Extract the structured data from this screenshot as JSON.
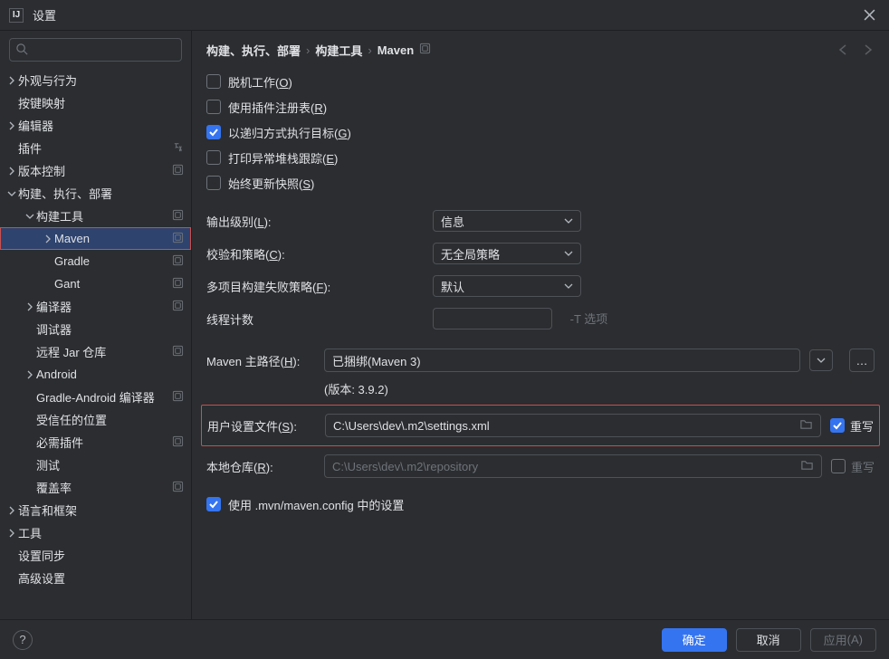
{
  "window": {
    "title": "设置"
  },
  "search": {
    "placeholder": ""
  },
  "sidebar": {
    "items": [
      {
        "label": "外观与行为",
        "indent": 0,
        "arrow": "right"
      },
      {
        "label": "按键映射",
        "indent": 0
      },
      {
        "label": "编辑器",
        "indent": 0,
        "arrow": "right"
      },
      {
        "label": "插件",
        "indent": 0,
        "lang": true
      },
      {
        "label": "版本控制",
        "indent": 0,
        "arrow": "right",
        "proj": true
      },
      {
        "label": "构建、执行、部署",
        "indent": 0,
        "arrow": "down"
      },
      {
        "label": "构建工具",
        "indent": 1,
        "arrow": "down",
        "proj": true
      },
      {
        "label": "Maven",
        "indent": 2,
        "arrow": "right",
        "proj": true,
        "selected": true
      },
      {
        "label": "Gradle",
        "indent": 2,
        "proj": true
      },
      {
        "label": "Gant",
        "indent": 2,
        "proj": true
      },
      {
        "label": "编译器",
        "indent": 1,
        "arrow": "right",
        "proj": true
      },
      {
        "label": "调试器",
        "indent": 1
      },
      {
        "label": "远程 Jar 仓库",
        "indent": 1,
        "proj": true
      },
      {
        "label": "Android",
        "indent": 1,
        "arrow": "right"
      },
      {
        "label": "Gradle-Android 编译器",
        "indent": 1,
        "proj": true
      },
      {
        "label": "受信任的位置",
        "indent": 1
      },
      {
        "label": "必需插件",
        "indent": 1,
        "proj": true
      },
      {
        "label": "测试",
        "indent": 1
      },
      {
        "label": "覆盖率",
        "indent": 1,
        "proj": true
      },
      {
        "label": "语言和框架",
        "indent": 0,
        "arrow": "right"
      },
      {
        "label": "工具",
        "indent": 0,
        "arrow": "right"
      },
      {
        "label": "设置同步",
        "indent": 0
      },
      {
        "label": "高级设置",
        "indent": 0
      }
    ]
  },
  "breadcrumb": {
    "b1": "构建、执行、部署",
    "b2": "构建工具",
    "b3": "Maven"
  },
  "checks": {
    "offline": "脱机工作",
    "offline_accel": "O",
    "plugin": "使用插件注册表",
    "plugin_accel": "R",
    "recursive": "以递归方式执行目标",
    "recursive_accel": "G",
    "stacktrace": "打印异常堆栈跟踪",
    "stacktrace_accel": "E",
    "snapshots": "始终更新快照",
    "snapshots_accel": "S",
    "useconfig": "使用 .mvn/maven.config 中的设置"
  },
  "selects": {
    "output": {
      "label": "输出级别",
      "accel": "L",
      "value": "信息"
    },
    "checksum": {
      "label": "校验和策略",
      "accel": "C",
      "value": "无全局策略"
    },
    "failure": {
      "label": "多项目构建失败策略",
      "accel": "F",
      "value": "默认"
    }
  },
  "thread": {
    "label": "线程计数",
    "hint": "-T 选项"
  },
  "home": {
    "label": "Maven 主路径",
    "accel": "H",
    "value": "已捆绑(Maven 3)",
    "version": "(版本: 3.9.2)"
  },
  "usersettings": {
    "label": "用户设置文件",
    "accel": "S",
    "value": "C:\\Users\\dev\\.m2\\settings.xml",
    "overridelabel": "重写",
    "override": true
  },
  "localrepo": {
    "label": "本地仓库",
    "accel": "R",
    "value": "C:\\Users\\dev\\.m2\\repository",
    "overridelabel": "重写",
    "override": false
  },
  "buttons": {
    "ok": "确定",
    "cancel": "取消",
    "apply": "应用",
    "apply_accel": "A"
  }
}
